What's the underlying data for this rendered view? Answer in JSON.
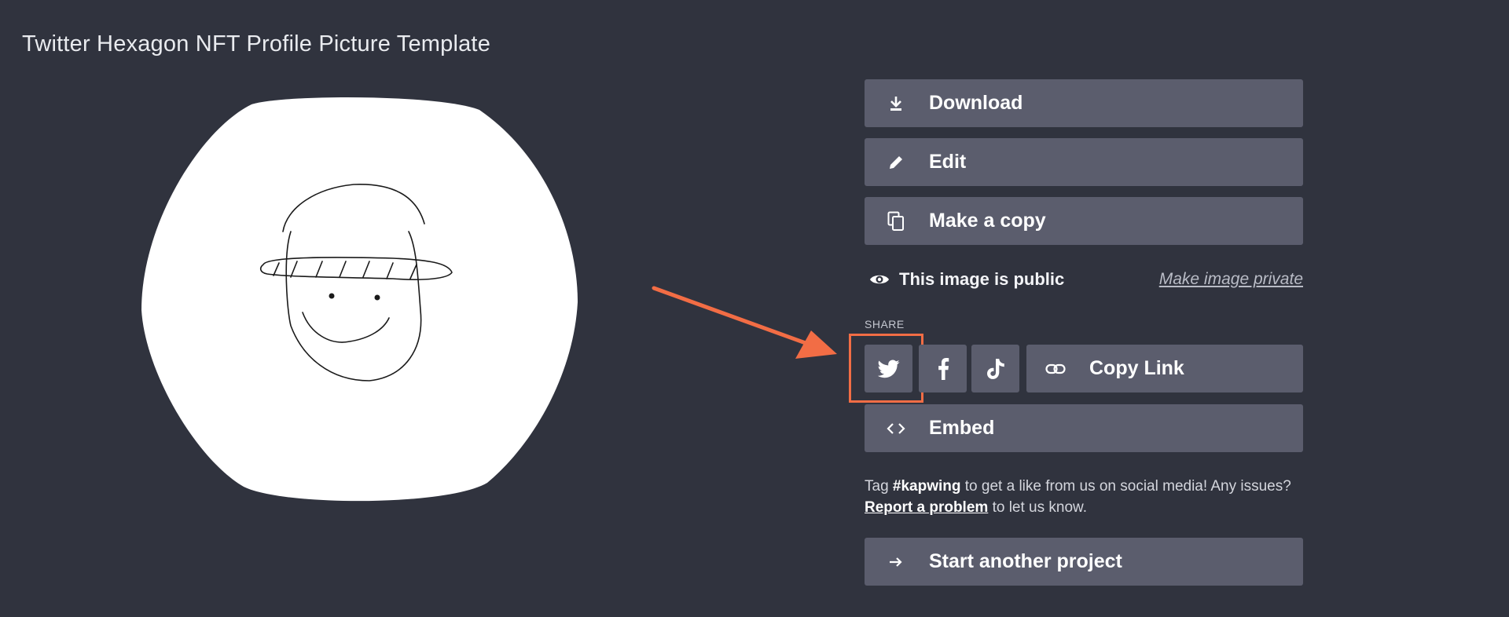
{
  "page": {
    "title": "Twitter Hexagon NFT Profile Picture Template"
  },
  "actions": {
    "download_label": "Download",
    "edit_label": "Edit",
    "copy_label": "Make a copy",
    "embed_label": "Embed",
    "start_label": "Start another project"
  },
  "visibility": {
    "status_text": "This image is public",
    "toggle_link": "Make image private"
  },
  "share": {
    "label": "SHARE",
    "copy_link_label": "Copy Link",
    "platforms": [
      "twitter",
      "facebook",
      "tiktok"
    ]
  },
  "footer": {
    "tag_prefix": "Tag ",
    "hashtag": "#kapwing",
    "tag_middle": " to get a like from us on social media! Any issues? ",
    "report_link": "Report a problem",
    "tag_suffix": " to let us know."
  },
  "icons": {
    "download": "download-icon",
    "edit": "pencil-icon",
    "copy": "copy-icon",
    "visibility": "eye-icon",
    "twitter": "twitter-icon",
    "facebook": "facebook-icon",
    "tiktok": "tiktok-icon",
    "link": "link-icon",
    "embed": "code-icon",
    "start": "arrow-right-icon"
  },
  "colors": {
    "background": "#30333e",
    "button": "#5b5d6d",
    "annotation": "#f26d45",
    "hexagon": "#ffffff"
  }
}
